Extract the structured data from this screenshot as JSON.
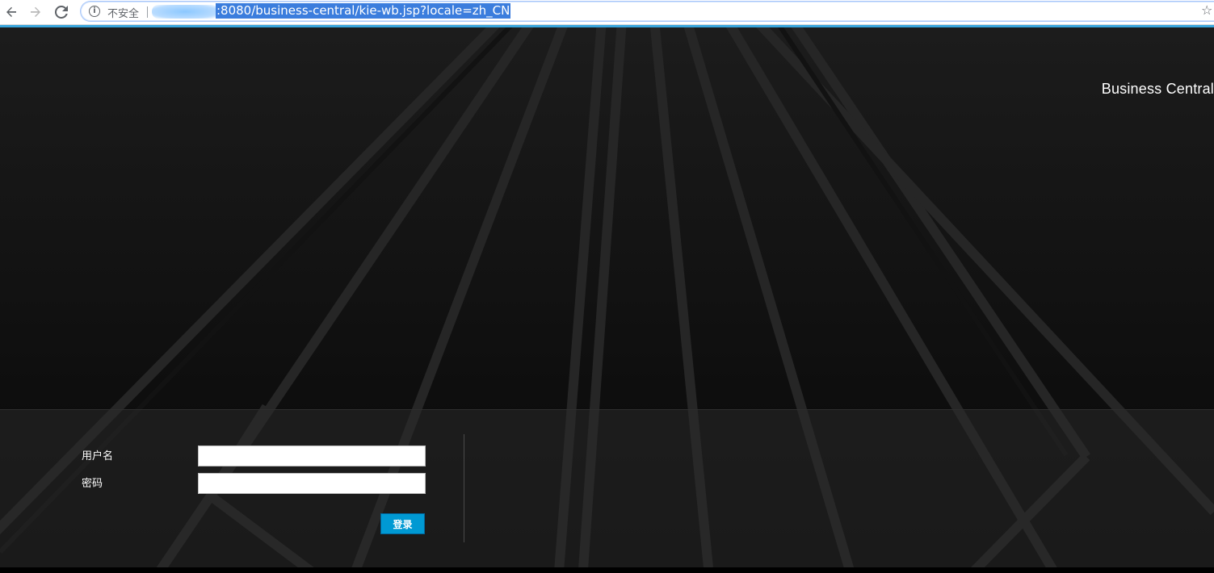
{
  "browser": {
    "security_label": "不安全",
    "url": ":8080/business-central/kie-wb.jsp?locale=zh_CN",
    "icons": {
      "back": "back-arrow-icon",
      "forward": "forward-arrow-icon",
      "reload": "reload-icon",
      "info": "info-icon",
      "bookmark": "star-icon"
    },
    "accent_color": "#39a5dc"
  },
  "page": {
    "brand_title": "Business Central",
    "background_color": "#000000"
  },
  "login": {
    "username_label": "用户名",
    "username_value": "",
    "password_label": "密码",
    "password_value": "",
    "submit_label": "登录",
    "button_color": "#0099d3"
  }
}
